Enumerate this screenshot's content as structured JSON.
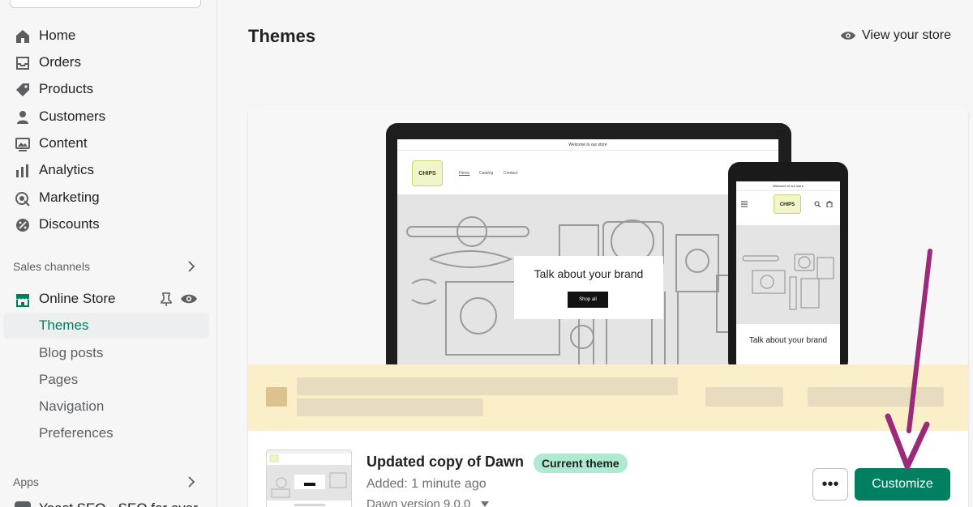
{
  "sidebar": {
    "items": [
      {
        "label": "Home",
        "icon": "home-icon"
      },
      {
        "label": "Orders",
        "icon": "inbox-icon"
      },
      {
        "label": "Products",
        "icon": "tag-icon"
      },
      {
        "label": "Customers",
        "icon": "person-icon"
      },
      {
        "label": "Content",
        "icon": "image-icon"
      },
      {
        "label": "Analytics",
        "icon": "bar-chart-icon"
      },
      {
        "label": "Marketing",
        "icon": "target-icon"
      },
      {
        "label": "Discounts",
        "icon": "discount-icon"
      }
    ],
    "sales_channels_label": "Sales channels",
    "online_store_label": "Online Store",
    "online_store_subitems": [
      "Themes",
      "Blog posts",
      "Pages",
      "Navigation",
      "Preferences"
    ],
    "apps_label": "Apps",
    "apps_partial": "Yoast SEO - SEO for ever"
  },
  "header": {
    "title": "Themes",
    "view_store": "View your store"
  },
  "preview": {
    "desktop": {
      "announcement": "Welcome to our store",
      "logo": "CHIPS",
      "nav": [
        "Home",
        "Catalog",
        "Contact"
      ],
      "hero_text": "Talk about your brand",
      "hero_button": "Shop all"
    },
    "mobile": {
      "announcement": "Welcome to our store",
      "logo": "CHIPS",
      "hero_text": "Talk about your brand"
    }
  },
  "theme": {
    "name": "Updated copy of Dawn",
    "badge": "Current theme",
    "added": "Added: 1 minute ago",
    "version": "Dawn version 9.0.0",
    "more_label": "•••",
    "customize_label": "Customize"
  },
  "colors": {
    "accent": "#008060",
    "active_text": "#007f5f",
    "badge_bg": "#aee9d1",
    "arrow": "#9b2a78"
  }
}
